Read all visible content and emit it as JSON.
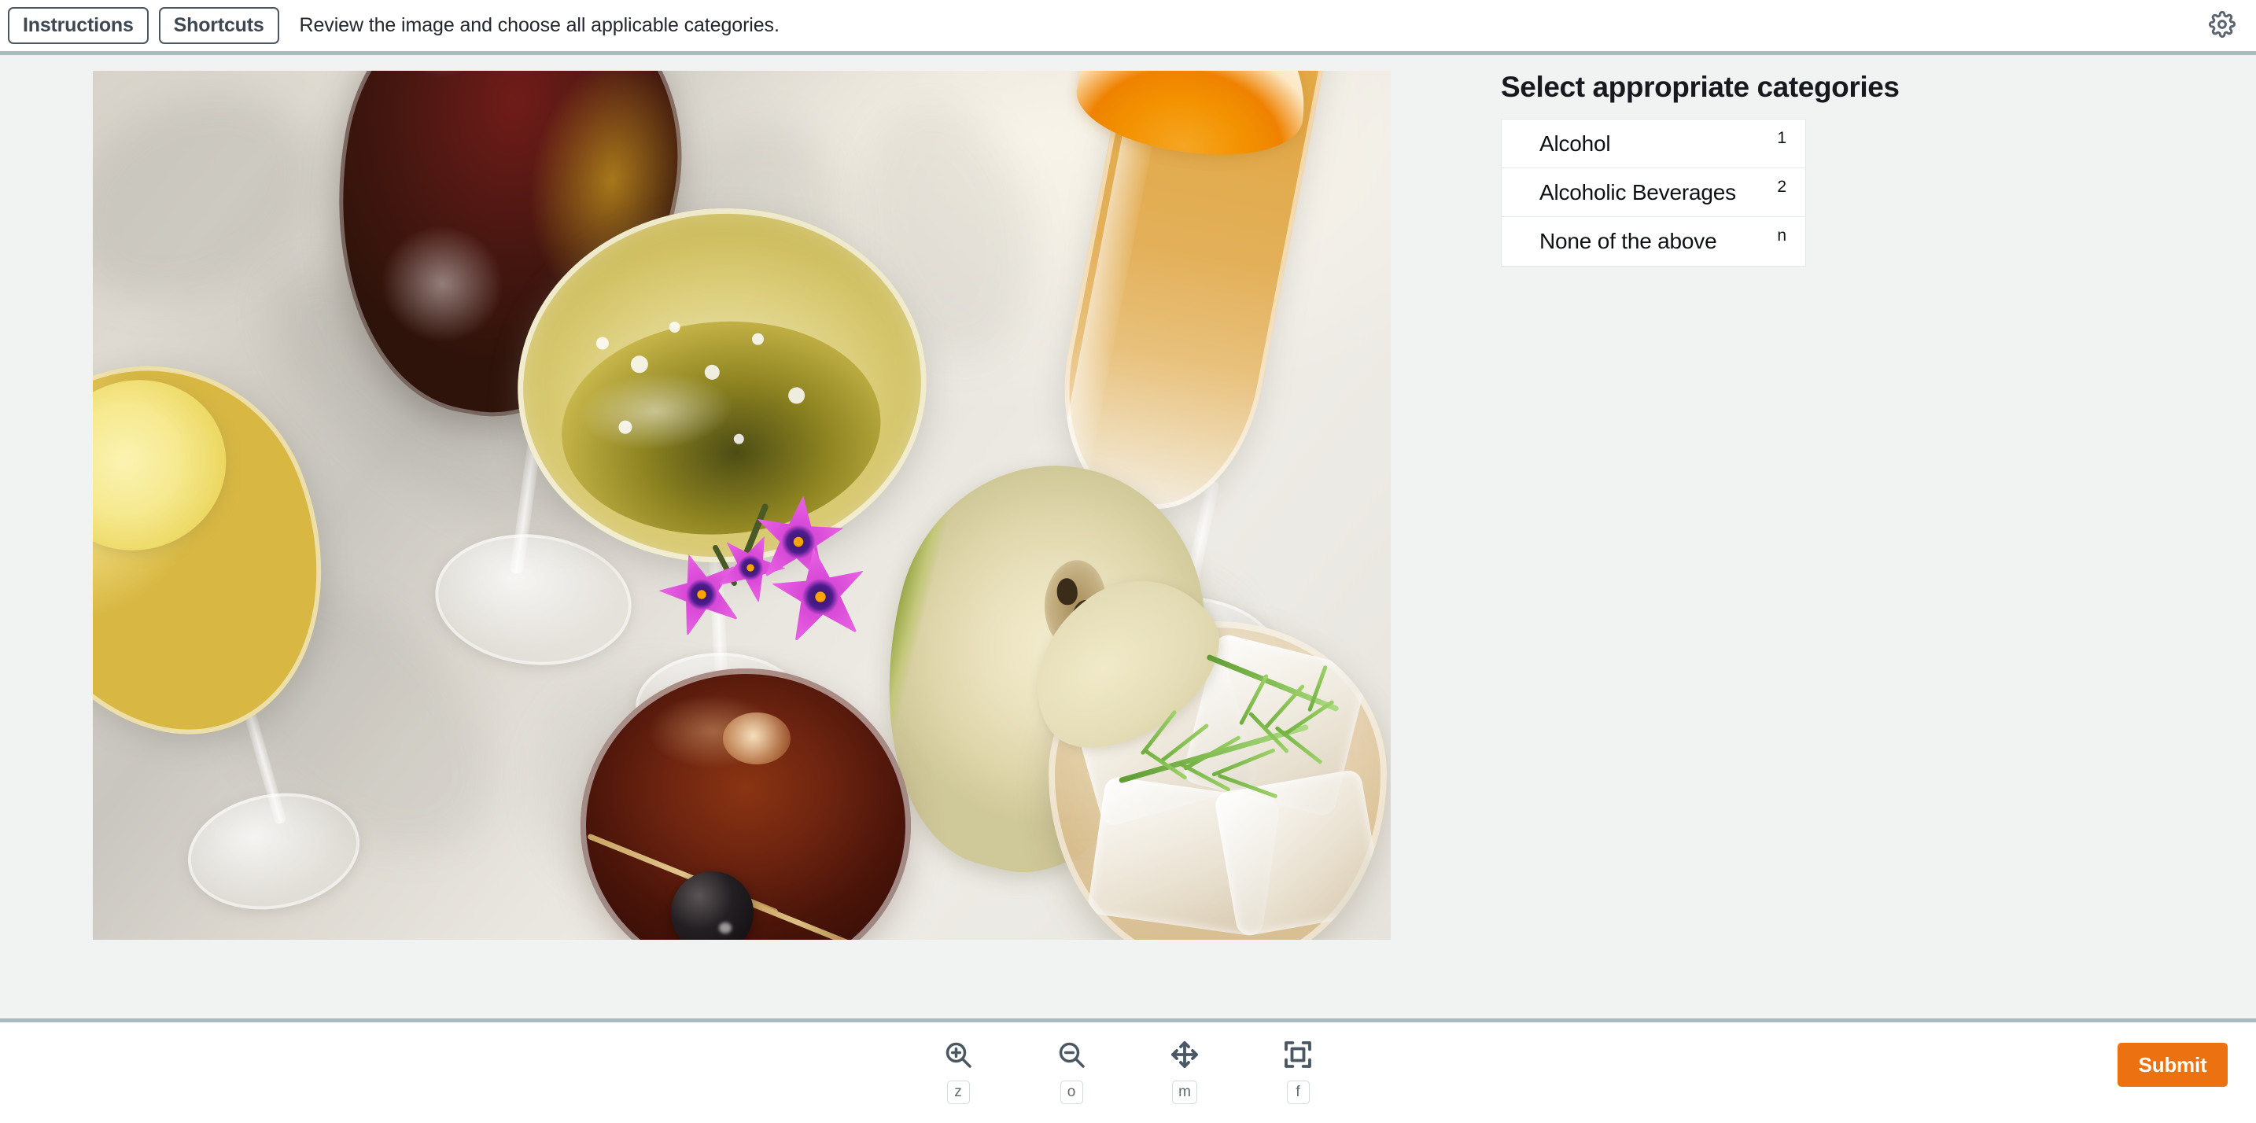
{
  "header": {
    "instructions_label": "Instructions",
    "shortcuts_label": "Shortcuts",
    "prompt": "Review the image and choose all applicable categories.",
    "settings_icon": "gear-icon"
  },
  "task": {
    "panel_title": "Select appropriate categories",
    "categories": [
      {
        "label": "Alcohol",
        "hotkey": "1"
      },
      {
        "label": "Alcoholic Beverages",
        "hotkey": "2"
      },
      {
        "label": "None of the above",
        "hotkey": "n"
      }
    ]
  },
  "image": {
    "alt": "Overhead photo of assorted cocktails and wine glasses on a cream tablecloth with orange slice, pear halves, purple flowers and a rosemary garnish",
    "subjects": [
      "red wine glass",
      "white wine glass with lemon slice",
      "coupe glass of sparkling wine with purple flowers",
      "champagne flute with orange slice",
      "manhattan cocktail with dark cherry on pick",
      "pear half",
      "rocks glass with ice and rosemary sprig"
    ]
  },
  "footer": {
    "tools": [
      {
        "name": "zoom-in",
        "icon": "zoom-in-icon",
        "hotkey": "z"
      },
      {
        "name": "zoom-out",
        "icon": "zoom-out-icon",
        "hotkey": "o"
      },
      {
        "name": "pan",
        "icon": "move-icon",
        "hotkey": "m"
      },
      {
        "name": "fit-to-screen",
        "icon": "fit-screen-icon",
        "hotkey": "f"
      }
    ],
    "submit_label": "Submit"
  },
  "colors": {
    "accent": "#ec7211",
    "divider": "#a8bcc0",
    "canvas_bg": "#f1f3f3",
    "text": "#16191d"
  }
}
